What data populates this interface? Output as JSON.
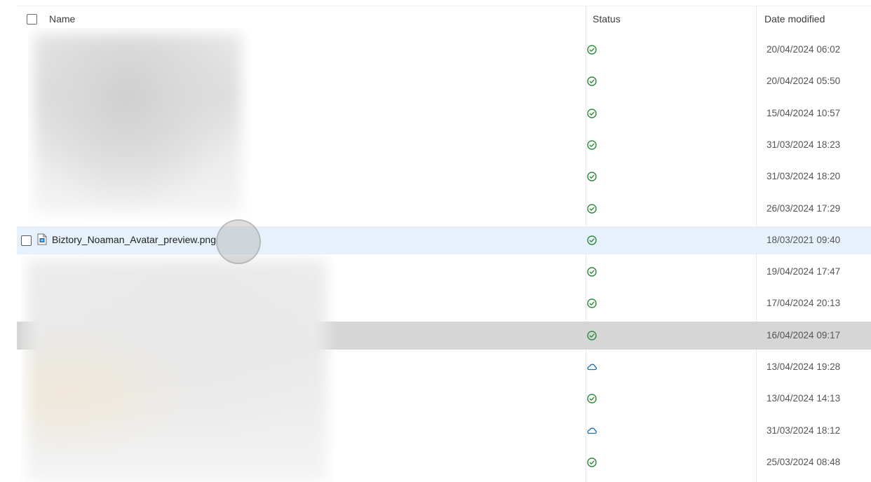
{
  "columns": {
    "name": "Name",
    "status": "Status",
    "date_modified": "Date modified"
  },
  "highlighted_file": {
    "name": "Biztory_Noaman_Avatar_preview.png",
    "icon": "image-file-icon"
  },
  "rows": [
    {
      "status": "synced",
      "date": "20/04/2024 06:02"
    },
    {
      "status": "synced",
      "date": "20/04/2024 05:50"
    },
    {
      "status": "synced",
      "date": "15/04/2024 10:57"
    },
    {
      "status": "synced",
      "date": "31/03/2024 18:23"
    },
    {
      "status": "synced",
      "date": "31/03/2024 18:20"
    },
    {
      "status": "synced",
      "date": "26/03/2024 17:29"
    },
    {
      "status": "synced",
      "date": "18/03/2021 09:40"
    },
    {
      "status": "synced",
      "date": "19/04/2024 17:47"
    },
    {
      "status": "synced",
      "date": "17/04/2024 20:13"
    },
    {
      "status": "synced",
      "date": "16/04/2024 09:17"
    },
    {
      "status": "cloud",
      "date": "13/04/2024 19:28"
    },
    {
      "status": "synced",
      "date": "13/04/2024 14:13"
    },
    {
      "status": "cloud",
      "date": "31/03/2024 18:12"
    },
    {
      "status": "synced",
      "date": "25/03/2024 08:48"
    }
  ],
  "colors": {
    "synced": "#2e8b3e",
    "cloud": "#1e6ea7",
    "hover_row": "#e6f1fb",
    "selected_row": "#d6d6d6"
  }
}
